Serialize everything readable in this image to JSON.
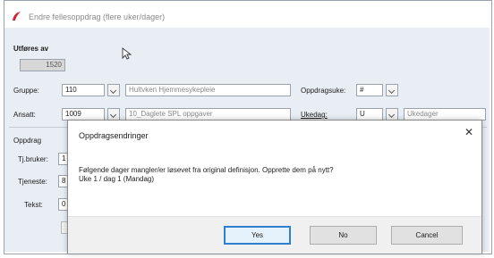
{
  "window": {
    "title": "Endre fellesoppdrag (flere uker/dager)"
  },
  "form": {
    "utfores_label": "Utføres av",
    "utfores_value": "1520",
    "gruppe_label": "Gruppe:",
    "gruppe_code": "110",
    "gruppe_name": "Hultvken Hjemmesykepleie",
    "oppdragsuke_label": "Oppdragsuke:",
    "oppdragsuke_value": "#",
    "ansatt_label": "Ansatt:",
    "ansatt_code": "1009",
    "ansatt_name": "10_Daglete SPL oppgaver",
    "ukedag_label": "Ukedag:",
    "ukedag_value": "U",
    "ukedag_name": "Ukedager",
    "oppdrag_label": "Oppdrag",
    "tjbruker_label": "Tj.bruker:",
    "tjbruker_value": "1",
    "tjeneste_label": "Tjeneste:",
    "tjeneste_value": "8",
    "tekst_label": "Tekst:",
    "tekst_value": "0"
  },
  "dialog": {
    "title": "Oppdragsendringer",
    "close_symbol": "✕",
    "message_line1": "Følgende dager mangler/er løsevet fra original definisjon. Opprette dem på nytt?",
    "message_line2": "Uke 1 / dag 1 (Mandag)",
    "buttons": {
      "yes": "Yes",
      "no": "No",
      "cancel": "Cancel"
    }
  },
  "colors": {
    "accent": "#2f7fd1",
    "app_icon": "#d0283a",
    "panel": "#e9eef4"
  },
  "icons": {
    "app": "app-logo-icon",
    "cursor": "mouse-pointer-icon",
    "close": "close-icon",
    "dropdown": "chevron-down-icon"
  }
}
